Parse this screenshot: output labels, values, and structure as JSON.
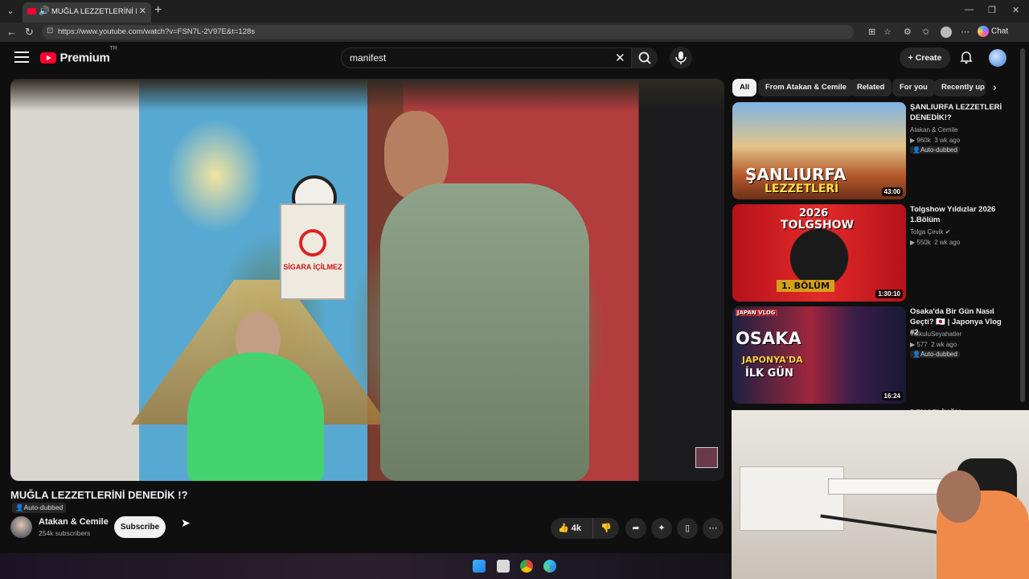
{
  "browser": {
    "tab_title": "MUĞLA LEZZETLERİNİ DENEDİK !?",
    "url": "https://www.youtube.com/watch?v=FSN7L-2V97E&t=128s",
    "chat_label": "Chat"
  },
  "header": {
    "brand": "Premium",
    "brand_region": "TR",
    "search_value": "manifest",
    "create_label": "Create"
  },
  "video": {
    "title": "MUĞLA LEZZETLERİNİ DENEDİK !?",
    "badge": "Auto-dubbed",
    "channel": "Atakan & Cemile",
    "subscribers": "254k subscribers",
    "subscribe_label": "Subscribe",
    "likes": "4k",
    "overlay_sign": "SİGARA İÇİLMEZ"
  },
  "chips": [
    "All",
    "From Atakan & Cemile",
    "Related",
    "For you",
    "Recently up"
  ],
  "related": [
    {
      "title": "ŞANLIURFA LEZZETLERİ DENEDİK!?",
      "channel": "Atakan & Cemile",
      "views": "960k",
      "age": "3 wk ago",
      "badge": "Auto-dubbed",
      "duration": "43:00",
      "thumb_text": [
        "ŞANLIURFA",
        "LEZZETLERİ"
      ]
    },
    {
      "title": "Tolgshow Yıldızlar 2026 1.Bölüm",
      "channel": "Tolga Çevik",
      "views": "550k",
      "age": "2 wk ago",
      "badge": "",
      "duration": "1:30:10",
      "thumb_text": [
        "2026",
        "TOLGSHOW",
        "1. BÖLÜM"
      ]
    },
    {
      "title": "Osaka'da Bir Gün Nasıl Geçti? 🇯🇵 | Japonya Vlog #2",
      "channel": "TutkuluSeyahatler",
      "views": "577",
      "age": "2 wk ago",
      "badge": "Auto-dubbed",
      "duration": "16:24",
      "thumb_text": [
        "OSAKA",
        "JAPONYA'DA",
        "İLK GÜN",
        "JAPAN VLOG"
      ]
    },
    {
      "title": "DENGELİKÖY LEZZETLERİNİ",
      "channel": "",
      "views": "",
      "age": "",
      "badge": "",
      "duration": "",
      "thumb_text": []
    }
  ]
}
